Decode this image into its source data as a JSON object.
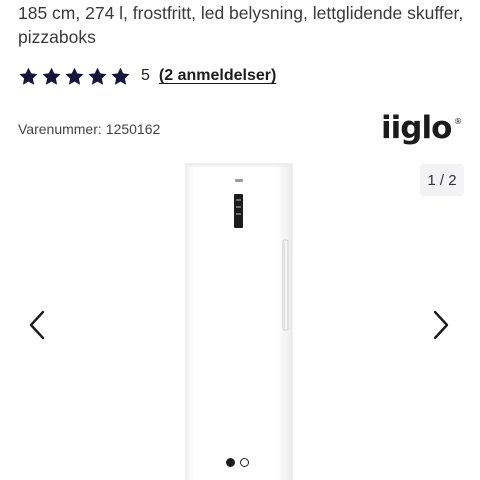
{
  "product": {
    "subtitle": "185 cm, 274 l, frostfritt, led belysning, lettglidende skuffer, pizzaboks",
    "sku_label": "Varenummer:",
    "sku_value": "1250162"
  },
  "rating": {
    "stars": 5,
    "max": 5,
    "value": "5",
    "reviews_link": "(2 anmeldelser)",
    "star_color": "#16163a"
  },
  "brand": {
    "name": "iiglo",
    "registered": "®"
  },
  "gallery": {
    "counter": "1 / 2",
    "current_slide": 1,
    "total_slides": 2,
    "prev_icon": "chevron-left-icon",
    "next_icon": "chevron-right-icon"
  }
}
